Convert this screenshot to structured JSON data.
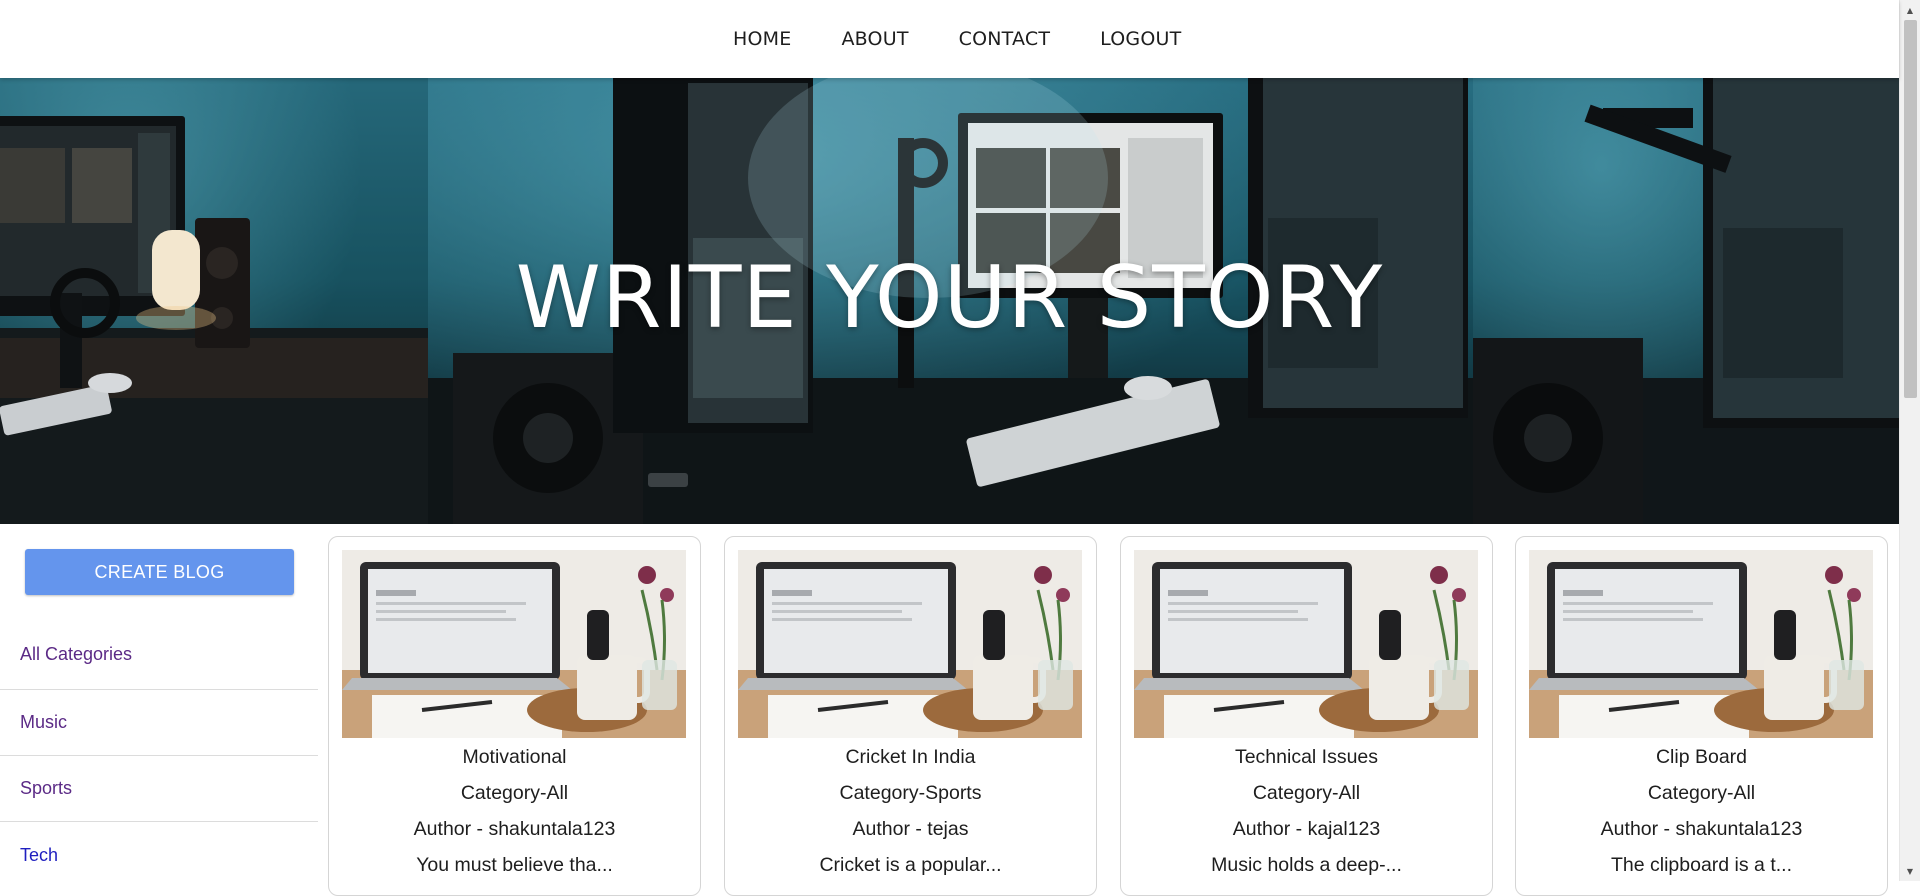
{
  "nav": {
    "items": [
      {
        "label": "HOME"
      },
      {
        "label": "ABOUT"
      },
      {
        "label": "CONTACT"
      },
      {
        "label": "LOGOUT"
      }
    ]
  },
  "hero": {
    "title": "WRITE YOUR STORY"
  },
  "sidebar": {
    "create_label": "CREATE BLOG",
    "create_color": "#6495ed",
    "categories": [
      {
        "label": "All Categories"
      },
      {
        "label": "Music"
      },
      {
        "label": "Sports"
      },
      {
        "label": "Tech"
      }
    ]
  },
  "posts": [
    {
      "title": "Motivational",
      "category": "Category-All",
      "author": "Author - shakuntala123",
      "excerpt": "You must believe tha..."
    },
    {
      "title": "Cricket In India",
      "category": "Category-Sports",
      "author": "Author - tejas",
      "excerpt": "Cricket is a popular..."
    },
    {
      "title": "Technical Issues",
      "category": "Category-All",
      "author": "Author - kajal123",
      "excerpt": "Music holds a deep-..."
    },
    {
      "title": "Clip Board",
      "category": "Category-All",
      "author": "Author - shakuntala123",
      "excerpt": "The clipboard is a t..."
    }
  ]
}
